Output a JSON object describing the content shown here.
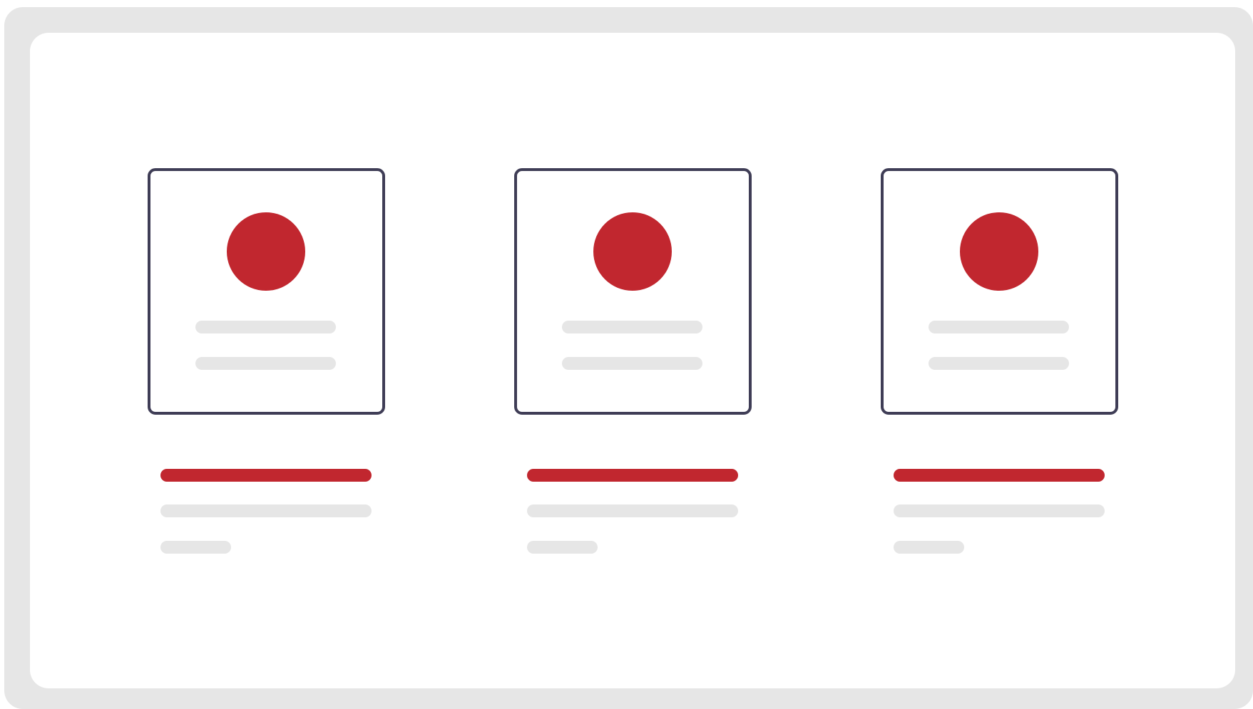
{
  "colors": {
    "frame": "#e6e6e6",
    "panel": "#ffffff",
    "outline": "#3f3d56",
    "accent": "#c1272f",
    "placeholder": "#e6e6e6"
  },
  "cards": [
    {
      "id": "card-1",
      "avatar": "user-avatar-icon"
    },
    {
      "id": "card-2",
      "avatar": "user-avatar-icon"
    },
    {
      "id": "card-3",
      "avatar": "user-avatar-icon"
    }
  ]
}
